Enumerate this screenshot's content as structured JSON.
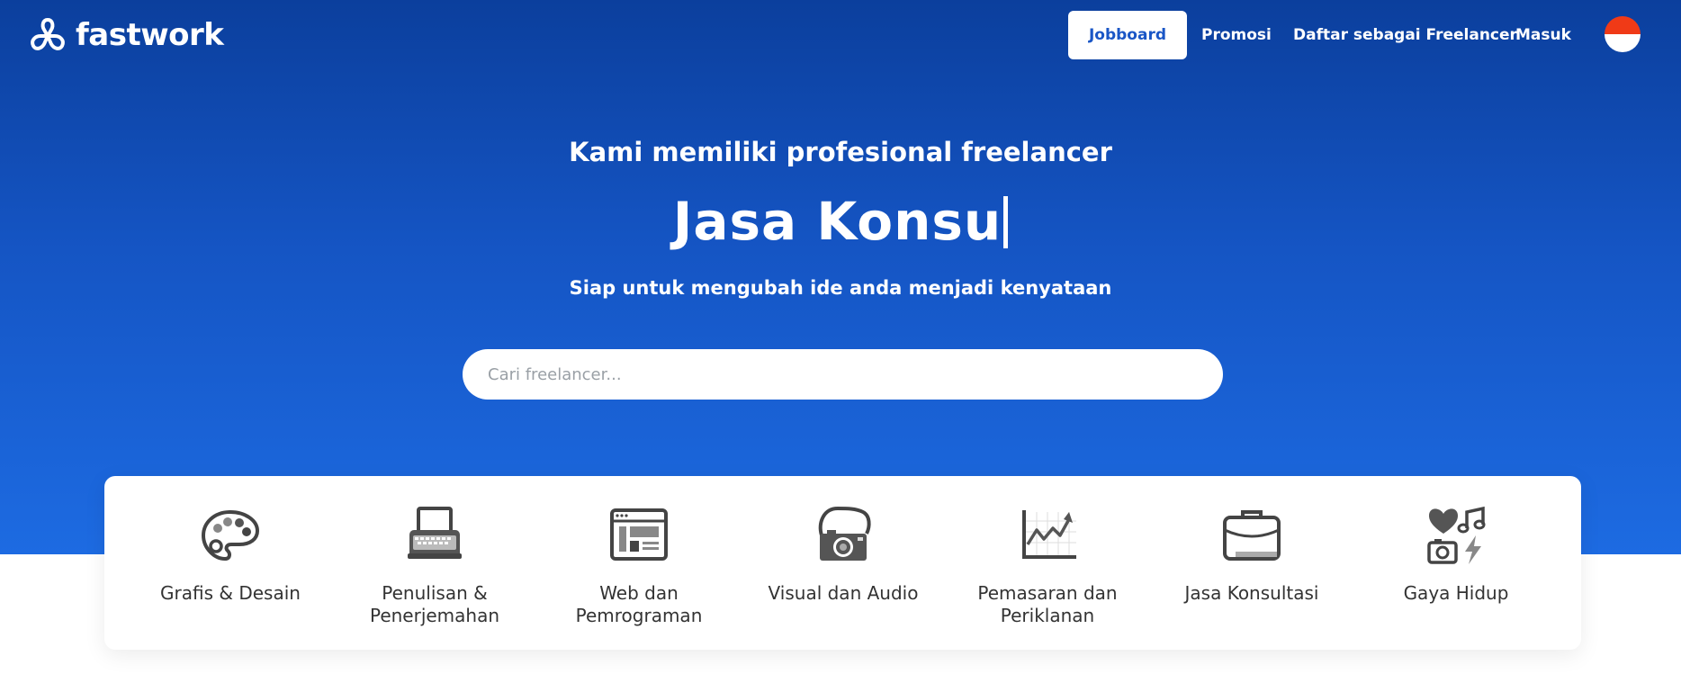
{
  "nav": {
    "brand": "fastwork",
    "jobboard": "Jobboard",
    "promosi": "Promosi",
    "daftar": "Daftar sebagai Freelancer",
    "masuk": "Masuk"
  },
  "hero": {
    "line1": "Kami memiliki profesional freelancer",
    "typing": "Jasa Konsu",
    "line3": "Siap untuk mengubah ide anda menjadi kenyataan",
    "search_placeholder": "Cari freelancer..."
  },
  "categories": [
    {
      "label": "Grafis & Desain",
      "icon": "palette-icon"
    },
    {
      "label": "Penulisan & Penerjemahan",
      "icon": "typewriter-icon"
    },
    {
      "label": "Web dan Pemrograman",
      "icon": "browser-window-icon"
    },
    {
      "label": "Visual dan Audio",
      "icon": "camera-icon"
    },
    {
      "label": "Pemasaran dan Periklanan",
      "icon": "chart-growth-icon"
    },
    {
      "label": "Jasa Konsultasi",
      "icon": "briefcase-icon"
    },
    {
      "label": "Gaya Hidup",
      "icon": "lifestyle-icon"
    }
  ],
  "colors": {
    "hero_top": "#0b3f9d",
    "hero_bottom": "#1d6be2",
    "accent": "#1a56c6",
    "icon_dark": "#444444",
    "icon_mid": "#8a8a8a"
  }
}
